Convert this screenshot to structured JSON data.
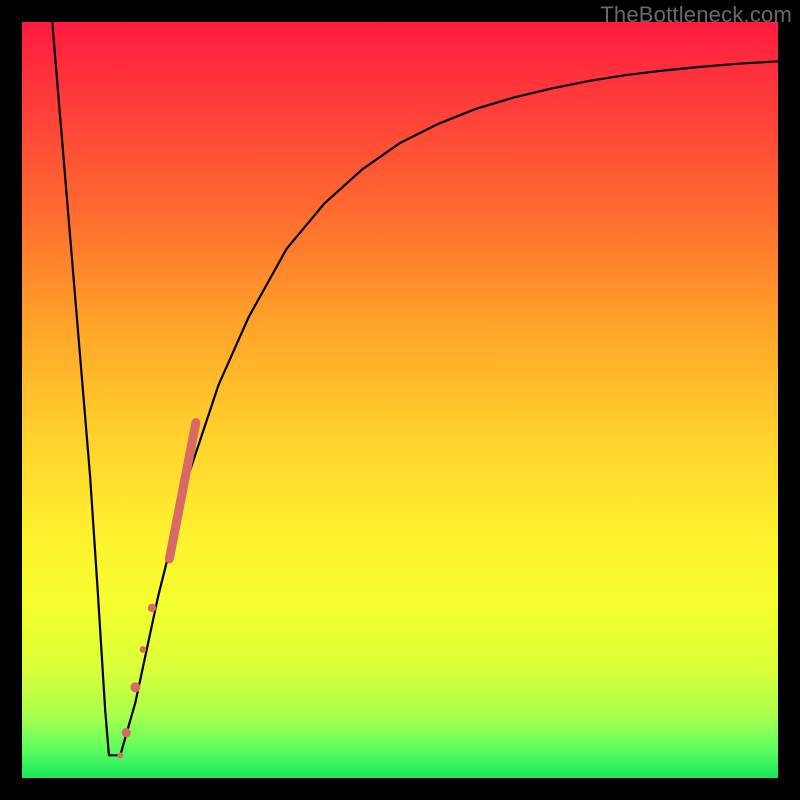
{
  "watermark": "TheBottleneck.com",
  "colors": {
    "frame": "#000000",
    "curve": "#000000",
    "marker": "#d86a66",
    "gradient_top": "#ff1b3f",
    "gradient_bottom": "#18e85c"
  },
  "chart_data": {
    "type": "line",
    "title": "",
    "xlabel": "",
    "ylabel": "",
    "xlim": [
      0,
      100
    ],
    "ylim": [
      0,
      100
    ],
    "series": [
      {
        "name": "bottleneck-curve",
        "x": [
          4,
          5,
          6,
          7,
          8,
          9,
          10,
          11,
          11.5,
          12,
          13,
          15,
          18,
          22,
          26,
          30,
          35,
          40,
          45,
          50,
          55,
          60,
          65,
          70,
          75,
          80,
          85,
          90,
          95,
          100
        ],
        "y": [
          100,
          88,
          76,
          64,
          52,
          40,
          25,
          9,
          3,
          3,
          3,
          10,
          24,
          40,
          52,
          61,
          70,
          76,
          80.5,
          84,
          86.5,
          88.5,
          90,
          91.2,
          92.2,
          93,
          93.6,
          94.1,
          94.5,
          94.8
        ]
      }
    ],
    "markers": [
      {
        "name": "cluster-main",
        "x": 19.5,
        "y_start": 29,
        "y_end": 47,
        "thickness": 9
      },
      {
        "name": "dot-a",
        "x": 17.2,
        "y": 22.5,
        "r": 4.2
      },
      {
        "name": "dot-b",
        "x": 16.0,
        "y": 17.0,
        "r": 3.4
      },
      {
        "name": "dot-c",
        "x": 15.0,
        "y": 12.0,
        "r": 5.0
      },
      {
        "name": "dot-d",
        "x": 13.8,
        "y": 6.0,
        "r": 4.6
      },
      {
        "name": "dot-e",
        "x": 13.0,
        "y": 3.0,
        "r": 3.0
      }
    ]
  }
}
